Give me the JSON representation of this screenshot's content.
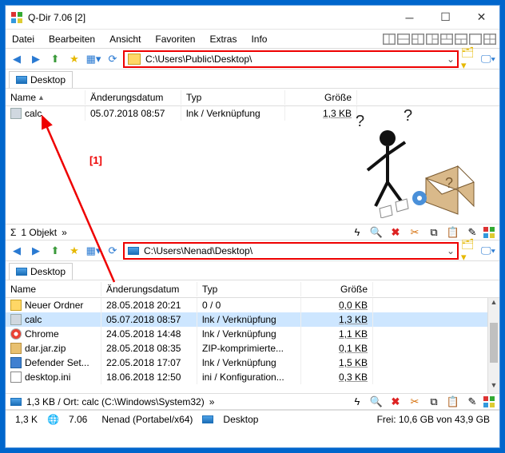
{
  "window": {
    "title": "Q-Dir 7.06 [2]"
  },
  "menu": {
    "file": "Datei",
    "edit": "Bearbeiten",
    "view": "Ansicht",
    "fav": "Favoriten",
    "extras": "Extras",
    "info": "Info"
  },
  "pane1": {
    "path": "C:\\Users\\Public\\Desktop\\",
    "tab": "Desktop",
    "cols": {
      "name": "Name",
      "mod": "Änderungsdatum",
      "type": "Typ",
      "size": "Größe"
    },
    "rows": [
      {
        "name": "calc",
        "mod": "05.07.2018 08:57",
        "type": "lnk / Verknüpfung",
        "size": "1,3 KB",
        "icon": "calc"
      }
    ],
    "status": "1 Objekt"
  },
  "pane2": {
    "path": "C:\\Users\\Nenad\\Desktop\\",
    "tab": "Desktop",
    "cols": {
      "name": "Name",
      "mod": "Änderungsdatum",
      "type": "Typ",
      "size": "Größe"
    },
    "rows": [
      {
        "name": "Neuer Ordner",
        "mod": "28.05.2018 20:21",
        "type": "0 / 0",
        "size": "0,0 KB",
        "icon": "folder"
      },
      {
        "name": "calc",
        "mod": "05.07.2018 08:57",
        "type": "lnk / Verknüpfung",
        "size": "1,3 KB",
        "icon": "calc",
        "sel": true
      },
      {
        "name": "Chrome",
        "mod": "24.05.2018 14:48",
        "type": "lnk / Verknüpfung",
        "size": "1,1 KB",
        "icon": "chrome"
      },
      {
        "name": "dar.jar.zip",
        "mod": "28.05.2018 08:35",
        "type": "ZIP-komprimierte...",
        "size": "0,1 KB",
        "icon": "zip"
      },
      {
        "name": "Defender Set...",
        "mod": "22.05.2018 17:07",
        "type": "lnk / Verknüpfung",
        "size": "1,5 KB",
        "icon": "def"
      },
      {
        "name": "desktop.ini",
        "mod": "18.06.2018 12:50",
        "type": "ini / Konfiguration...",
        "size": "0,3 KB",
        "icon": "ini"
      }
    ],
    "status": "1,3 KB / Ort: calc (C:\\Windows\\System32)"
  },
  "global": {
    "sizecell": "1,3 K",
    "ver": "7.06",
    "user": "Nenad (Portabel/x64)",
    "loc": "Desktop",
    "free": "Frei: 10,6 GB von 43,9 GB"
  },
  "annotation": {
    "label": "[1]"
  },
  "sigma": "Σ"
}
